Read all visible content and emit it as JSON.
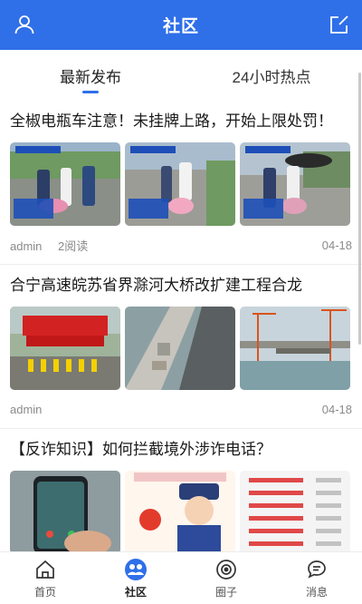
{
  "header": {
    "title": "社区",
    "left_icon": "user-icon",
    "right_icon": "compose-icon"
  },
  "tabs": [
    {
      "label": "最新发布",
      "active": true
    },
    {
      "label": "24小时热点",
      "active": false
    }
  ],
  "posts": [
    {
      "title": "全椒电瓶车注意！未挂牌上路，开始上限处罚！",
      "author": "admin",
      "reads": "2阅读",
      "date": "04-18",
      "images": [
        "police-stop-photo",
        "police-stop-photo",
        "police-stop-photo"
      ]
    },
    {
      "title": "合宁高速皖苏省界滁河大桥改扩建工程合龙",
      "author": "admin",
      "reads": "",
      "date": "04-18",
      "images": [
        "ceremony-photo",
        "bridge-photo",
        "bridge-crane-photo"
      ]
    },
    {
      "title": "【反诈知识】如何拦截境外涉诈电话？",
      "author": "",
      "reads": "",
      "date": "",
      "images": [
        "phone-call-photo",
        "police-cartoon",
        "phone-number-list"
      ]
    }
  ],
  "bottom_nav": [
    {
      "label": "首页",
      "icon": "home-icon",
      "active": false
    },
    {
      "label": "社区",
      "icon": "community-icon",
      "active": true
    },
    {
      "label": "圈子",
      "icon": "circle-icon",
      "active": false
    },
    {
      "label": "消息",
      "icon": "message-icon",
      "active": false
    }
  ],
  "colors": {
    "brand": "#2f6fe8",
    "meta_text": "#8a8a8a"
  }
}
